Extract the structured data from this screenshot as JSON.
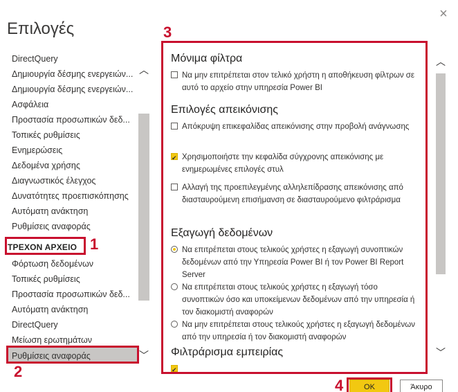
{
  "dialog": {
    "title": "Επιλογές",
    "close_glyph": "×"
  },
  "nav": {
    "global_items": [
      "DirectQuery",
      "Δημιουργία δέσμης ενεργειών...",
      "Δημιουργία δέσμης ενεργειών...",
      "Ασφάλεια",
      "Προστασία προσωπικών δεδ...",
      "Τοπικές ρυθμίσεις",
      "Ενημερώσεις",
      "Δεδομένα χρήσης",
      "Διαγνωστικός έλεγχος",
      "Δυνατότητες προεπισκόπησης",
      "Αυτόματη ανάκτηση",
      "Ρυθμίσεις αναφοράς"
    ],
    "section_label": "ΤΡΕΧΟΝ ΑΡΧΕΙΟ",
    "file_items": [
      "Φόρτωση δεδομένων",
      "Τοπικές ρυθμίσεις",
      "Προστασία προσωπικών δεδ...",
      "Αυτόματη ανάκτηση",
      "DirectQuery",
      "Μείωση ερωτημάτων",
      "Ρυθμίσεις αναφοράς"
    ],
    "selected_item": "Ρυθμίσεις αναφοράς"
  },
  "annotations": {
    "marker_1": "1",
    "marker_2": "2",
    "marker_3": "3",
    "marker_4": "4",
    "color": "#c8102e"
  },
  "pane": {
    "persistent_filters": {
      "heading": "Μόνιμα φίλτρα",
      "options": [
        {
          "text": "Να μην επιτρέπεται στον τελικό χρήστη η αποθήκευση φίλτρων σε αυτό το αρχείο στην υπηρεσία Power BI",
          "checked": false
        }
      ]
    },
    "visual_options": {
      "heading": "Επιλογές απεικόνισης",
      "options": [
        {
          "text": "Απόκρυψη επικεφαλίδας απεικόνισης στην προβολή ανάγνωσης",
          "checked": false
        },
        {
          "text": "Χρησιμοποιήστε την κεφαλίδα σύγχρονης απεικόνισης με ενημερωμένες επιλογές στυλ",
          "checked": true
        },
        {
          "text": "Αλλαγή της προεπιλεγμένης αλληλεπίδρασης απεικόνισης από διασταυρούμενη επισήμανση σε διασταυρούμενο φιλτράρισμα",
          "checked": false
        }
      ]
    },
    "export_data": {
      "heading": "Εξαγωγή δεδομένων",
      "options": [
        {
          "text": "Να επιτρέπεται στους τελικούς χρήστες η εξαγωγή συνοπτικών δεδομένων από την Υπηρεσία Power BI ή τον Power BI Report Server",
          "selected": true
        },
        {
          "text": "Να επιτρέπεται στους τελικούς χρήστες η εξαγωγή τόσο συνοπτικών όσο και υποκείμενων δεδομένων από την υπηρεσία ή τον διακομιστή αναφορών",
          "selected": false
        },
        {
          "text": "Να μην επιτρέπεται στους τελικούς χρήστες η εξαγωγή δεδομένων από την υπηρεσία ή τον διακομιστή αναφορών",
          "selected": false
        }
      ]
    },
    "filtering_experience": {
      "heading": "Φιλτράρισμα εμπειρίας"
    }
  },
  "buttons": {
    "ok": "OK",
    "cancel": "Άκυρο"
  },
  "colors": {
    "accent": "#f2c811",
    "highlight": "#c8102e",
    "selection": "#c8c6c4"
  }
}
